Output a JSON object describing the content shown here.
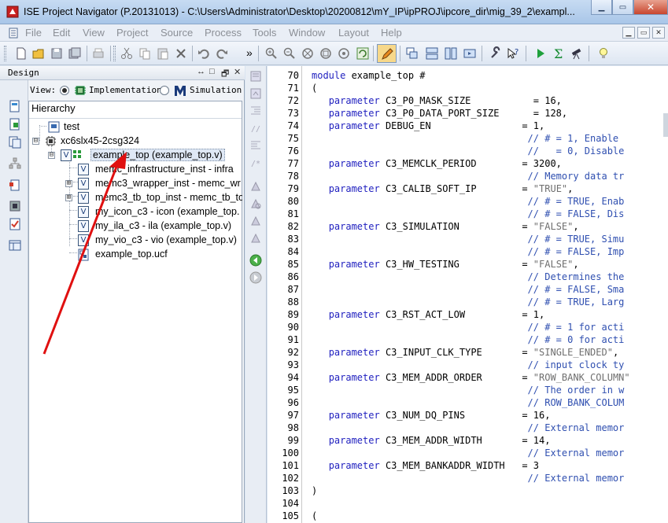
{
  "window": {
    "title": "ISE Project Navigator (P.20131013) - C:\\Users\\Administrator\\Desktop\\20200812\\mY_IP\\ipPROJ\\ipcore_dir\\mig_39_2\\exampl...",
    "min_label": "▁",
    "max_label": "▭",
    "close_label": "✕"
  },
  "menu": {
    "items": [
      "File",
      "Edit",
      "View",
      "Project",
      "Source",
      "Process",
      "Tools",
      "Window",
      "Layout",
      "Help"
    ],
    "mdi": [
      "▁",
      "▭",
      "✕"
    ]
  },
  "toolbar": {
    "overflow_label": "»"
  },
  "design_panel": {
    "title": "Design",
    "header_buttons": [
      "↔",
      "□",
      "🗗",
      "✕"
    ],
    "view_label": "View:",
    "implementation_label": "Implementation",
    "simulation_label": "Simulation",
    "hierarchy_title": "Hierarchy",
    "tree": [
      {
        "label": "test",
        "icon": "project-icon"
      },
      {
        "label": "xc6slx45-2csg324",
        "icon": "chip-icon"
      },
      {
        "label": "example_top (example_top.v)",
        "icon": "verilog-top-icon"
      },
      {
        "label": "memc_infrastructure_inst - infra",
        "icon": "verilog-icon"
      },
      {
        "label": "memc3_wrapper_inst - memc_wr",
        "icon": "verilog-icon"
      },
      {
        "label": "memc3_tb_top_inst - memc_tb_to",
        "icon": "verilog-icon"
      },
      {
        "label": "my_icon_c3 - icon (example_top.",
        "icon": "verilog-icon"
      },
      {
        "label": "my_ila_c3 - ila (example_top.v)",
        "icon": "verilog-icon"
      },
      {
        "label": "my_vio_c3 - vio (example_top.v)",
        "icon": "verilog-icon"
      },
      {
        "label": "example_top.ucf",
        "icon": "ucf-icon"
      }
    ],
    "expand_sign": "⊞",
    "collapse_sign": "⊟",
    "vicon_letter": "V"
  },
  "editor": {
    "lines": [
      {
        "n": "70",
        "parts": [
          [
            "kw",
            "module"
          ],
          [
            "",
            " example_top #"
          ]
        ]
      },
      {
        "n": "71",
        "parts": [
          [
            "",
            "("
          ]
        ]
      },
      {
        "n": "72",
        "parts": [
          [
            "",
            "   "
          ],
          [
            "kw",
            "parameter"
          ],
          [
            "",
            " C3_P0_MASK_SIZE           = 16,"
          ]
        ]
      },
      {
        "n": "73",
        "parts": [
          [
            "",
            "   "
          ],
          [
            "kw",
            "parameter"
          ],
          [
            "",
            " C3_P0_DATA_PORT_SIZE      = 128,"
          ]
        ]
      },
      {
        "n": "74",
        "parts": [
          [
            "",
            "   "
          ],
          [
            "kw",
            "parameter"
          ],
          [
            "",
            " DEBUG_EN                = 1,"
          ]
        ]
      },
      {
        "n": "75",
        "parts": [
          [
            "",
            "                                      "
          ],
          [
            "cmt",
            "// # = 1, Enable"
          ]
        ]
      },
      {
        "n": "76",
        "parts": [
          [
            "",
            "                                      "
          ],
          [
            "cmt",
            "//   = 0, Disable"
          ]
        ]
      },
      {
        "n": "77",
        "parts": [
          [
            "",
            "   "
          ],
          [
            "kw",
            "parameter"
          ],
          [
            "",
            " C3_MEMCLK_PERIOD        = 3200,"
          ]
        ]
      },
      {
        "n": "78",
        "parts": [
          [
            "",
            "                                      "
          ],
          [
            "cmt",
            "// Memory data tr"
          ]
        ]
      },
      {
        "n": "79",
        "parts": [
          [
            "",
            "   "
          ],
          [
            "kw",
            "parameter"
          ],
          [
            "",
            " C3_CALIB_SOFT_IP        = "
          ],
          [
            "str",
            "\"TRUE\""
          ],
          [
            "",
            ","
          ]
        ]
      },
      {
        "n": "80",
        "parts": [
          [
            "",
            "                                      "
          ],
          [
            "cmt",
            "// # = TRUE, Enab"
          ]
        ]
      },
      {
        "n": "81",
        "parts": [
          [
            "",
            "                                      "
          ],
          [
            "cmt",
            "// # = FALSE, Dis"
          ]
        ]
      },
      {
        "n": "82",
        "parts": [
          [
            "",
            "   "
          ],
          [
            "kw",
            "parameter"
          ],
          [
            "",
            " C3_SIMULATION           = "
          ],
          [
            "str",
            "\"FALSE\""
          ],
          [
            "",
            ","
          ]
        ]
      },
      {
        "n": "83",
        "parts": [
          [
            "",
            "                                      "
          ],
          [
            "cmt",
            "// # = TRUE, Simu"
          ]
        ]
      },
      {
        "n": "84",
        "parts": [
          [
            "",
            "                                      "
          ],
          [
            "cmt",
            "// # = FALSE, Imp"
          ]
        ]
      },
      {
        "n": "85",
        "parts": [
          [
            "",
            "   "
          ],
          [
            "kw",
            "parameter"
          ],
          [
            "",
            " C3_HW_TESTING           = "
          ],
          [
            "str",
            "\"FALSE\""
          ],
          [
            "",
            ","
          ]
        ]
      },
      {
        "n": "86",
        "parts": [
          [
            "",
            "                                      "
          ],
          [
            "cmt",
            "// Determines the"
          ]
        ]
      },
      {
        "n": "87",
        "parts": [
          [
            "",
            "                                      "
          ],
          [
            "cmt",
            "// # = FALSE, Sma"
          ]
        ]
      },
      {
        "n": "88",
        "parts": [
          [
            "",
            "                                      "
          ],
          [
            "cmt",
            "// # = TRUE, Larg"
          ]
        ]
      },
      {
        "n": "89",
        "parts": [
          [
            "",
            "   "
          ],
          [
            "kw",
            "parameter"
          ],
          [
            "",
            " C3_RST_ACT_LOW          = 1,"
          ]
        ]
      },
      {
        "n": "90",
        "parts": [
          [
            "",
            "                                      "
          ],
          [
            "cmt",
            "// # = 1 for acti"
          ]
        ]
      },
      {
        "n": "91",
        "parts": [
          [
            "",
            "                                      "
          ],
          [
            "cmt",
            "// # = 0 for acti"
          ]
        ]
      },
      {
        "n": "92",
        "parts": [
          [
            "",
            "   "
          ],
          [
            "kw",
            "parameter"
          ],
          [
            "",
            " C3_INPUT_CLK_TYPE       = "
          ],
          [
            "str",
            "\"SINGLE_ENDED\""
          ],
          [
            "",
            ","
          ]
        ]
      },
      {
        "n": "93",
        "parts": [
          [
            "",
            "                                      "
          ],
          [
            "cmt",
            "// input clock ty"
          ]
        ]
      },
      {
        "n": "94",
        "parts": [
          [
            "",
            "   "
          ],
          [
            "kw",
            "parameter"
          ],
          [
            "",
            " C3_MEM_ADDR_ORDER       = "
          ],
          [
            "str",
            "\"ROW_BANK_COLUMN\""
          ]
        ]
      },
      {
        "n": "95",
        "parts": [
          [
            "",
            "                                      "
          ],
          [
            "cmt",
            "// The order in w"
          ]
        ]
      },
      {
        "n": "96",
        "parts": [
          [
            "",
            "                                      "
          ],
          [
            "cmt",
            "// ROW_BANK_COLUM"
          ]
        ]
      },
      {
        "n": "97",
        "parts": [
          [
            "",
            "   "
          ],
          [
            "kw",
            "parameter"
          ],
          [
            "",
            " C3_NUM_DQ_PINS          = 16,"
          ]
        ]
      },
      {
        "n": "98",
        "parts": [
          [
            "",
            "                                      "
          ],
          [
            "cmt",
            "// External memor"
          ]
        ]
      },
      {
        "n": "99",
        "parts": [
          [
            "",
            "   "
          ],
          [
            "kw",
            "parameter"
          ],
          [
            "",
            " C3_MEM_ADDR_WIDTH       = 14,"
          ]
        ]
      },
      {
        "n": "100",
        "parts": [
          [
            "",
            "                                      "
          ],
          [
            "cmt",
            "// External memor"
          ]
        ]
      },
      {
        "n": "101",
        "parts": [
          [
            "",
            "   "
          ],
          [
            "kw",
            "parameter"
          ],
          [
            "",
            " C3_MEM_BANKADDR_WIDTH   = 3"
          ]
        ]
      },
      {
        "n": "102",
        "parts": [
          [
            "",
            "                                      "
          ],
          [
            "cmt",
            "// External memor"
          ]
        ]
      },
      {
        "n": "103",
        "parts": [
          [
            "",
            ")"
          ]
        ]
      },
      {
        "n": "104",
        "parts": [
          [
            "",
            ""
          ]
        ]
      },
      {
        "n": "105",
        "parts": [
          [
            "",
            "("
          ]
        ]
      }
    ]
  },
  "colors": {
    "keyword": "#1f1fbf",
    "comment": "#2f4fb0",
    "string": "#6f6f6f",
    "annotation_arrow": "#e01010"
  }
}
